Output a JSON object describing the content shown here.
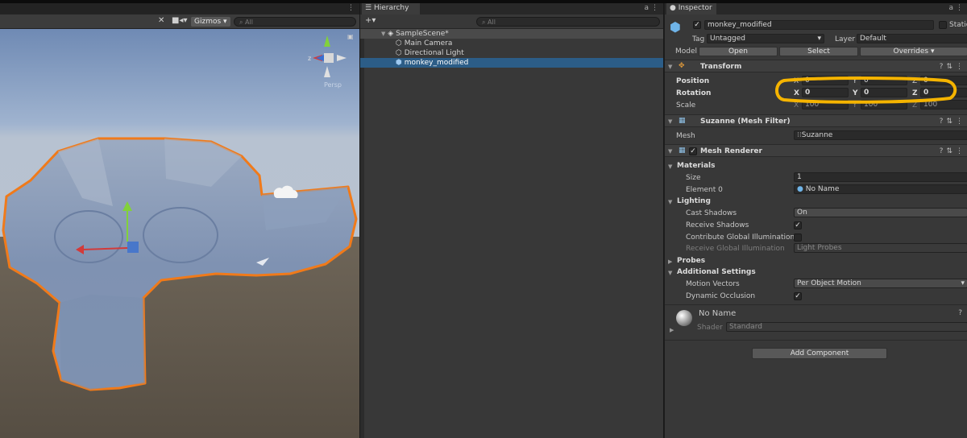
{
  "scene": {
    "gizmos_label": "Gizmos",
    "search_placeholder": "All",
    "persp_label": "Persp",
    "gizmo_axis_label": "z"
  },
  "hierarchy": {
    "tab_label": "Hierarchy",
    "add_label": "+▾",
    "search_placeholder": "All",
    "scene_name": "SampleScene*",
    "items": [
      {
        "label": "Main Camera"
      },
      {
        "label": "Directional Light"
      },
      {
        "label": "monkey_modified"
      }
    ]
  },
  "inspector": {
    "tab_label": "Inspector",
    "object_name": "monkey_modified",
    "static_label": "Static",
    "tag_label": "Tag",
    "tag_value": "Untagged",
    "layer_label": "Layer",
    "layer_value": "Default",
    "model_label": "Model",
    "open_label": "Open",
    "select_label": "Select",
    "overrides_label": "Overrides",
    "transform": {
      "title": "Transform",
      "position_label": "Position",
      "rotation_label": "Rotation",
      "scale_label": "Scale",
      "position": {
        "x": "0",
        "y": "0",
        "z": "0"
      },
      "rotation": {
        "x": "0",
        "y": "0",
        "z": "0"
      },
      "scale": {
        "x": "100",
        "y": "100",
        "z": "100"
      },
      "axis_x": "X",
      "axis_y": "Y",
      "axis_z": "Z"
    },
    "mesh_filter": {
      "title": "Suzanne (Mesh Filter)",
      "mesh_label": "Mesh",
      "mesh_value": "Suzanne"
    },
    "mesh_renderer": {
      "title": "Mesh Renderer",
      "materials_label": "Materials",
      "size_label": "Size",
      "size_value": "1",
      "element0_label": "Element 0",
      "element0_value": "No Name",
      "lighting_label": "Lighting",
      "cast_shadows_label": "Cast Shadows",
      "cast_shadows_value": "On",
      "receive_shadows_label": "Receive Shadows",
      "contribute_gi_label": "Contribute Global Illumination",
      "receive_gi_label": "Receive Global Illumination",
      "receive_gi_value": "Light Probes",
      "probes_label": "Probes",
      "additional_label": "Additional Settings",
      "motion_vectors_label": "Motion Vectors",
      "motion_vectors_value": "Per Object Motion",
      "dynamic_occlusion_label": "Dynamic Occlusion"
    },
    "material": {
      "name": "No Name",
      "shader_label": "Shader",
      "shader_value": "Standard"
    },
    "add_component_label": "Add Component"
  },
  "colors": {
    "selection_outline": "#f07a1a",
    "highlight_annotation": "#f5b400",
    "selected_row": "#2c5d87"
  }
}
